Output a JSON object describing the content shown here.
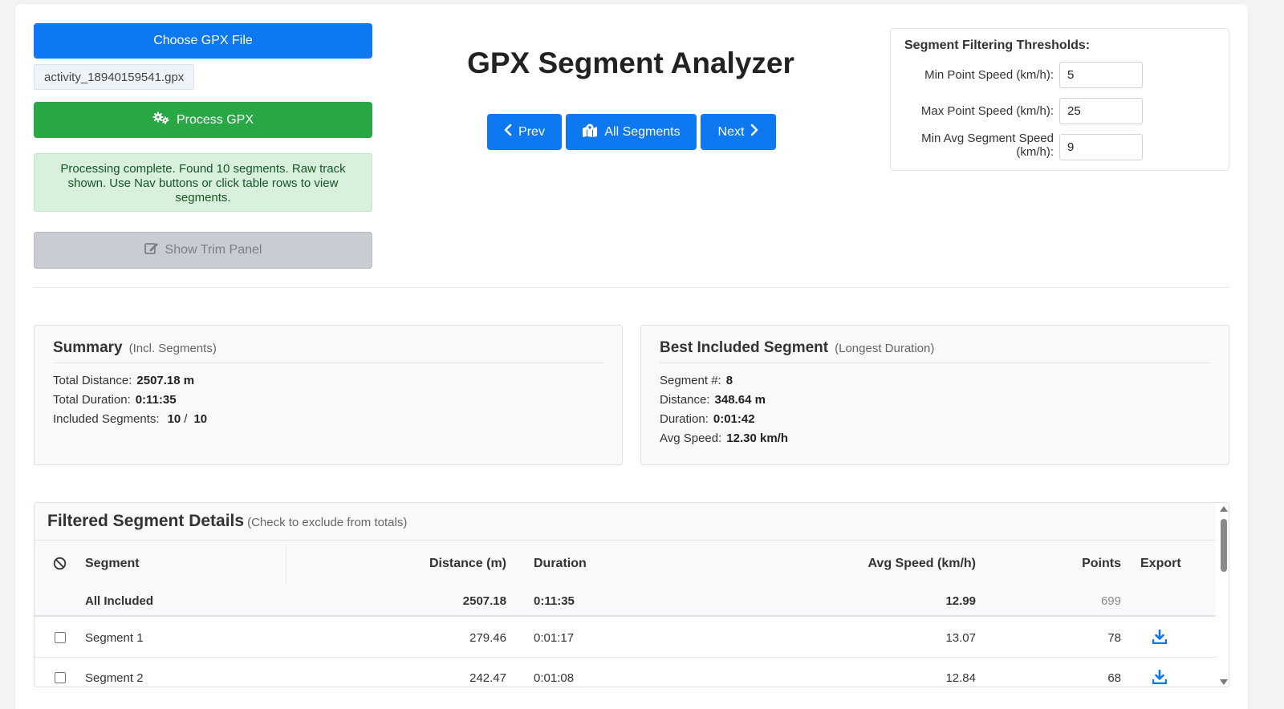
{
  "app": {
    "title": "GPX Segment Analyzer"
  },
  "file": {
    "choose_label": "Choose GPX File",
    "filename": "activity_18940159541.gpx",
    "process_label": "Process GPX",
    "status_message": "Processing complete. Found 10 segments. Raw track shown. Use Nav buttons or click table rows to view segments.",
    "trim_label": "Show Trim Panel"
  },
  "nav": {
    "prev_label": "Prev",
    "all_label": "All Segments",
    "next_label": "Next"
  },
  "thresholds": {
    "title": "Segment Filtering Thresholds:",
    "min_point_speed": {
      "label": "Min Point Speed (km/h):",
      "value": "5"
    },
    "max_point_speed": {
      "label": "Max Point Speed (km/h):",
      "value": "25"
    },
    "min_avg_speed": {
      "label": "Min Avg Segment Speed (km/h):",
      "value": "9"
    }
  },
  "summary": {
    "title": "Summary",
    "subtitle": "(Incl. Segments)",
    "total_distance_label": "Total Distance:",
    "total_distance": "2507.18 m",
    "total_duration_label": "Total Duration:",
    "total_duration": "0:11:35",
    "included_label": "Included Segments:",
    "included_count": "10",
    "included_sep": "/",
    "total_count": "10"
  },
  "best": {
    "title": "Best Included Segment",
    "subtitle": "(Longest Duration)",
    "segment_label": "Segment #:",
    "segment": "8",
    "distance_label": "Distance:",
    "distance": "348.64 m",
    "duration_label": "Duration:",
    "duration": "0:01:42",
    "speed_label": "Avg Speed:",
    "speed": "12.30 km/h"
  },
  "details": {
    "title": "Filtered Segment Details",
    "subtitle": "(Check to exclude from totals)",
    "headers": {
      "segment": "Segment",
      "distance": "Distance (m)",
      "duration": "Duration",
      "avg_speed": "Avg Speed (km/h)",
      "points": "Points",
      "export": "Export"
    },
    "all_row": {
      "label": "All Included",
      "distance": "2507.18",
      "duration": "0:11:35",
      "avg_speed": "12.99",
      "points": "699"
    },
    "rows": [
      {
        "name": "Segment 1",
        "distance": "279.46",
        "duration": "0:01:17",
        "avg_speed": "13.07",
        "points": "78"
      },
      {
        "name": "Segment 2",
        "distance": "242.47",
        "duration": "0:01:08",
        "avg_speed": "12.84",
        "points": "68"
      }
    ]
  },
  "colors": {
    "primary": "#0d78f0",
    "success": "#28a745",
    "disabled": "#c9ccd2",
    "status_bg": "#d8f0dc"
  }
}
